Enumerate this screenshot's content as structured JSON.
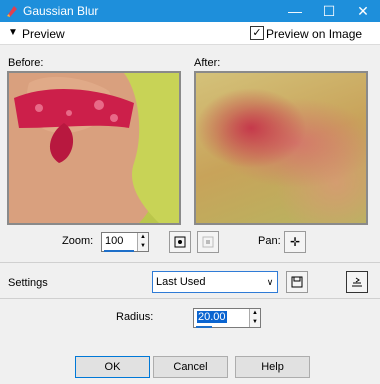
{
  "window": {
    "title": "Gaussian Blur",
    "minimize": "—",
    "maximize": "☐",
    "close": "✕"
  },
  "preview_section": {
    "label": "Preview",
    "preview_on_image_label": "Preview on Image",
    "preview_on_image_checked": true
  },
  "before": {
    "label": "Before:"
  },
  "after": {
    "label": "After:"
  },
  "zoom": {
    "label": "Zoom:",
    "value": "100"
  },
  "pan": {
    "label": "Pan:"
  },
  "settings": {
    "label": "Settings",
    "selected": "Last Used"
  },
  "radius": {
    "label": "Radius:",
    "value": "20.00"
  },
  "buttons": {
    "ok": "OK",
    "cancel": "Cancel",
    "help": "Help"
  },
  "colors": {
    "titlebar": "#1e8fdb",
    "accent": "#1e6fc9"
  }
}
